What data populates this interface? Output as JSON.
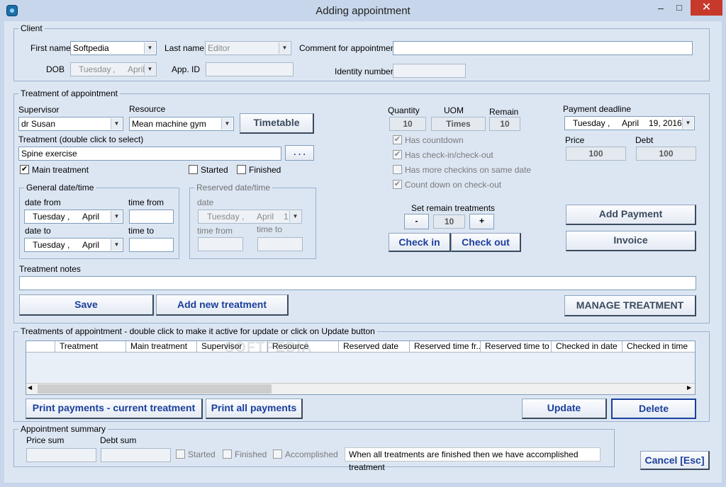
{
  "window": {
    "title": "Adding appointment",
    "minimize": "–",
    "maximize": "□",
    "close": "✕"
  },
  "client": {
    "legend": "Client",
    "first_name_label": "First name",
    "first_name": "Softpedia",
    "last_name_label": "Last name",
    "last_name": "Editor",
    "comment_label": "Comment for appointment",
    "comment": "",
    "dob_label": "DOB",
    "dob_day": "Tuesday",
    "dob_sep": ",",
    "dob_month": "April",
    "app_id_label": "App. ID",
    "app_id": "",
    "identity_label": "Identity number",
    "identity": ""
  },
  "treatment": {
    "legend": "Treatment of appointment",
    "supervisor_label": "Supervisor",
    "supervisor": "dr Susan",
    "resource_label": "Resource",
    "resource": "Mean machine gym",
    "timetable_btn": "Timetable",
    "treatment_label": "Treatment (double click to select)",
    "treatment": "Spine exercise",
    "browse_btn": ". . .",
    "main_treatment": "Main treatment",
    "started": "Started",
    "finished": "Finished",
    "general_legend": "General date/time",
    "date_from_label": "date from",
    "time_from_label": "time from",
    "date_to_label": "date to",
    "time_to_label": "time to",
    "date_from_day": "Tuesday",
    "date_from_sep": ",",
    "date_from_month": "April",
    "date_to_day": "Tuesday",
    "date_to_sep": ",",
    "date_to_month": "April",
    "reserved_legend": "Reserved date/time",
    "reserved_date_label": "date",
    "reserved_day": "Tuesday",
    "reserved_sep": ",",
    "reserved_month": "April",
    "reserved_num": "1",
    "reserved_time_from_label": "time from",
    "reserved_time_to_label": "time to",
    "quantity_label": "Quantity",
    "quantity": "10",
    "uom_label": "UOM",
    "uom": "Times",
    "remain_label": "Remain",
    "remain": "10",
    "has_countdown": "Has countdown",
    "has_checkin": "Has check-in/check-out",
    "more_checkins": "Has more checkins on same date",
    "count_down_checkout": "Count down on check-out",
    "set_remain_label": "Set remain treatments",
    "minus": "-",
    "remain_set": "10",
    "plus": "+",
    "checkin_btn": "Check in",
    "checkout_btn": "Check out",
    "deadline_label": "Payment deadline",
    "deadline_day": "Tuesday",
    "deadline_sep": ",",
    "deadline_month": "April",
    "deadline_date": "19, 2016",
    "price_label": "Price",
    "price": "100",
    "debt_label": "Debt",
    "debt": "100",
    "add_payment_btn": "Add Payment",
    "invoice_btn": "Invoice",
    "notes_label": "Treatment notes",
    "notes": "",
    "save_btn": "Save",
    "add_new_btn": "Add new treatment",
    "manage_btn": "MANAGE TREATMENT"
  },
  "list": {
    "legend": "Treatments of appointment - double click to make it active for update or click on Update button",
    "columns": [
      "Treatment",
      "Main treatment",
      "Supervisor",
      "Resource",
      "Reserved date",
      "Reserved time fr...",
      "Reserved time to",
      "Checked in date",
      "Checked in time"
    ],
    "scroll_left": "◀",
    "scroll_right": "▶",
    "print_current_btn": "Print payments - current treatment",
    "print_all_btn": "Print all payments",
    "update_btn": "Update",
    "delete_btn": "Delete"
  },
  "summary": {
    "legend": "Appointment summary",
    "price_sum_label": "Price sum",
    "debt_sum_label": "Debt sum",
    "started": "Started",
    "finished": "Finished",
    "accomplished": "Accomplished",
    "note": "When all treatments are finished then we have accomplished treatment"
  },
  "cancel_btn": "Cancel [Esc]",
  "watermark": "SOFTPEDIA"
}
